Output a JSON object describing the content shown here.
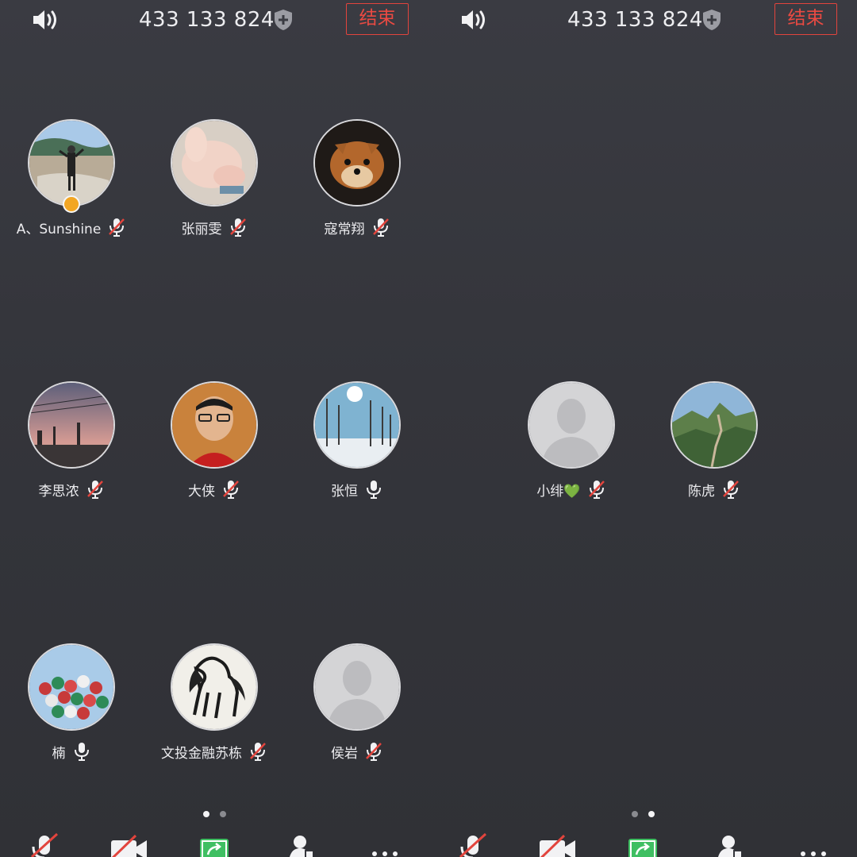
{
  "meeting": {
    "id": "433 133 824",
    "end_label": "结束"
  },
  "screens": [
    {
      "participants": [
        {
          "name": "A、Sunshine",
          "mic": "muted",
          "host": true,
          "avatar": "photo-person-landscape"
        },
        {
          "name": "张丽雯",
          "mic": "muted",
          "avatar": "photo-plush-toy"
        },
        {
          "name": "寇常翔",
          "mic": "muted",
          "avatar": "photo-pomeranian-dog"
        },
        {
          "name": "李思浓",
          "mic": "muted",
          "avatar": "photo-sunset-city"
        },
        {
          "name": "大侠",
          "mic": "muted",
          "avatar": "photo-man-portrait"
        },
        {
          "name": "张恒",
          "mic": "on",
          "avatar": "photo-winter-trees"
        },
        {
          "name": "楠",
          "mic": "on",
          "avatar": "photo-balloons"
        },
        {
          "name": "文投金融苏栋",
          "mic": "muted",
          "avatar": "photo-horse-ink"
        },
        {
          "name": "侯岩",
          "mic": "muted",
          "avatar": "default-avatar"
        }
      ],
      "page_indicator": {
        "total": 2,
        "active": 1
      }
    },
    {
      "participants": [
        {
          "name": "小绯💚",
          "mic": "muted",
          "avatar": "default-avatar"
        },
        {
          "name": "陈虎",
          "mic": "muted",
          "avatar": "photo-great-wall"
        }
      ],
      "page_indicator": {
        "total": 2,
        "active": 2
      }
    }
  ],
  "toolbar": {
    "items": [
      {
        "icon": "mic-muted-icon"
      },
      {
        "icon": "video-off-icon"
      },
      {
        "icon": "share-screen-icon"
      },
      {
        "icon": "participants-icon"
      },
      {
        "icon": "more-icon"
      }
    ]
  },
  "colors": {
    "background": "#34353b",
    "end_button": "#e2443d",
    "host_badge": "#f2a623",
    "share_green": "#3fbf62",
    "muted_slash": "#e2443d"
  }
}
